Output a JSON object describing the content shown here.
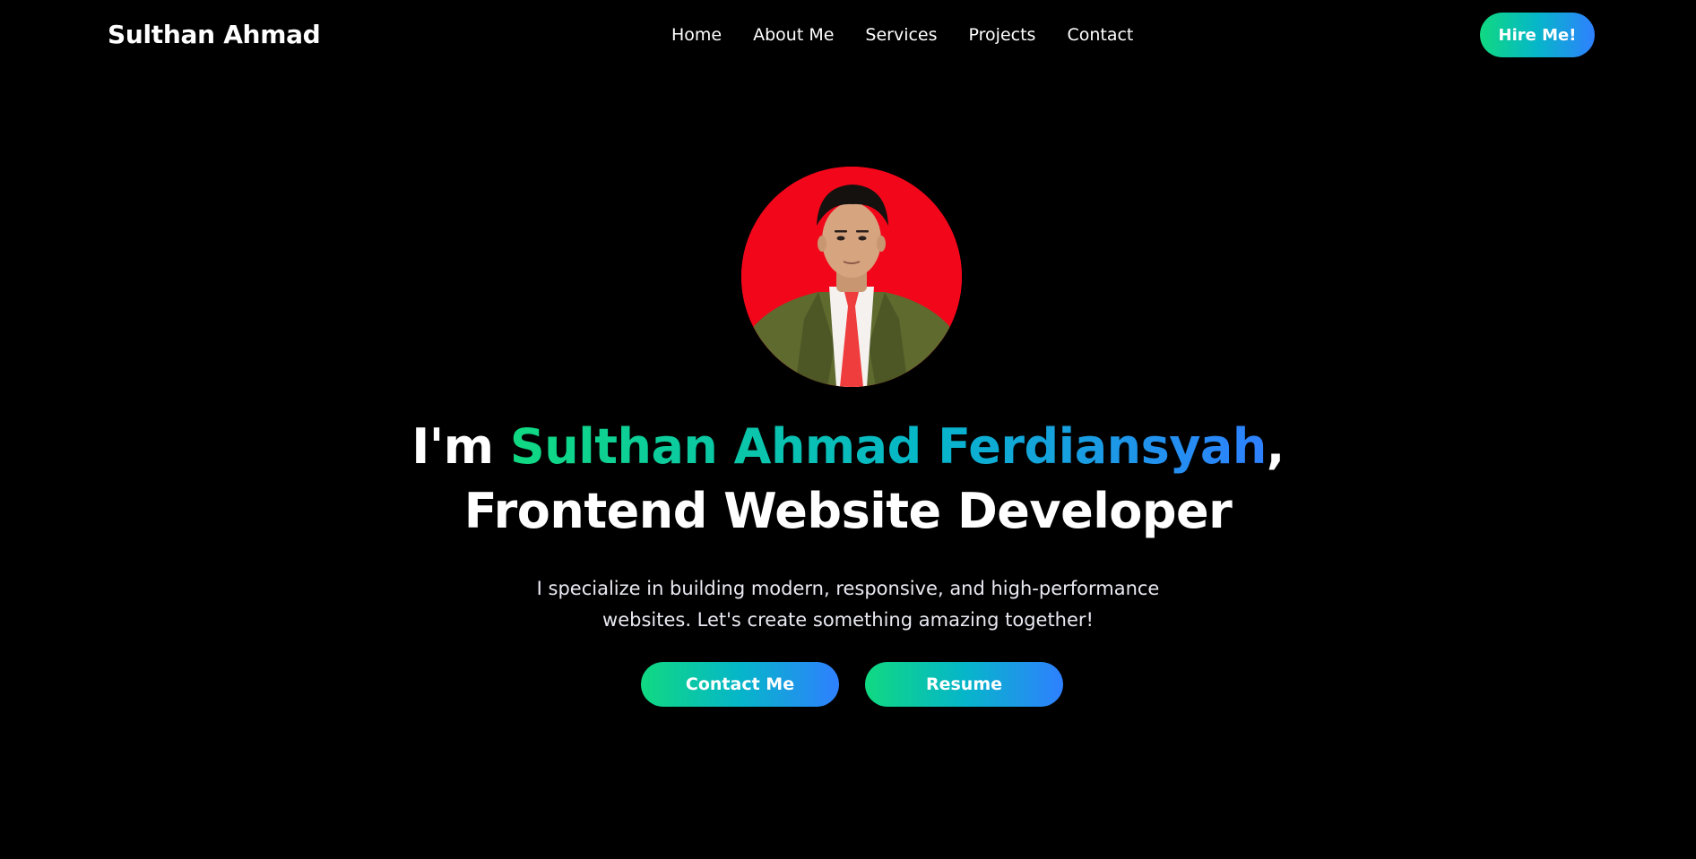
{
  "nav": {
    "brand": "Sulthan Ahmad",
    "links": [
      "Home",
      "About Me",
      "Services",
      "Projects",
      "Contact"
    ],
    "hire_label": "Hire Me!"
  },
  "hero": {
    "headline_prefix": "I'm ",
    "name": "Sulthan Ahmad Ferdiansyah",
    "headline_suffix": ",",
    "role": "Frontend Website Developer",
    "subtitle": "I specialize in building modern, responsive, and high-performance websites. Let's create something amazing together!",
    "contact_label": "Contact Me",
    "resume_label": "Resume"
  },
  "colors": {
    "background": "#000000",
    "accent_start": "#10d981",
    "accent_end": "#2f80ff",
    "avatar_background": "#f2061a"
  }
}
